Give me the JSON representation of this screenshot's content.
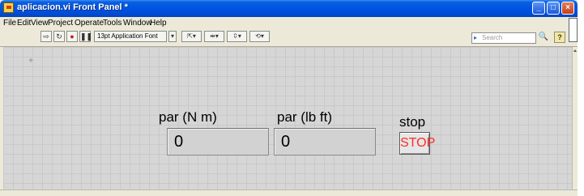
{
  "window": {
    "title": "aplicacion.vi Front Panel *"
  },
  "menubar": {
    "items": [
      "File",
      "Edit",
      "View",
      "Project",
      "Operate",
      "Tools",
      "Window",
      "Help"
    ]
  },
  "toolbar": {
    "font": "13pt Application Font",
    "search_placeholder": "Search"
  },
  "panel": {
    "controls": [
      {
        "label": "par (N m)",
        "value": "0"
      },
      {
        "label": "par (lb ft)",
        "value": "0"
      }
    ],
    "stop": {
      "label": "stop",
      "button_text": "STOP",
      "text_color": "#ff2a2a"
    }
  }
}
